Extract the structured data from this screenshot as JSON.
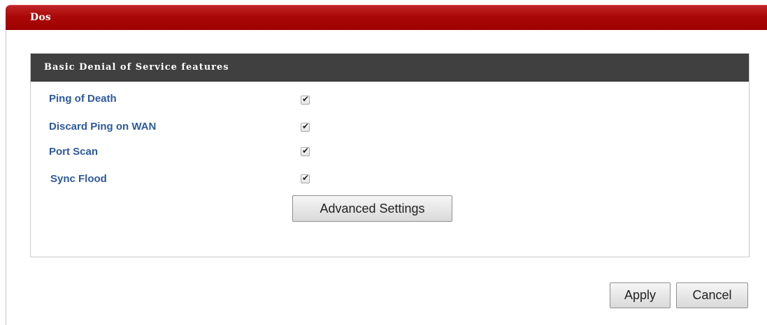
{
  "header": {
    "title": "Dos"
  },
  "panel": {
    "title": "Basic Denial of Service features",
    "rows": [
      {
        "label": "Ping of Death",
        "checked": true
      },
      {
        "label": "Discard Ping on WAN",
        "checked": true
      },
      {
        "label": "Port Scan",
        "checked": true
      },
      {
        "label": "Sync Flood",
        "checked": true
      }
    ],
    "check_glyph": "✔",
    "advanced_button": "Advanced Settings"
  },
  "actions": {
    "apply": "Apply",
    "cancel": "Cancel"
  },
  "colors": {
    "title_bar": "#a30000",
    "panel_header": "#404040",
    "label_text": "#2d5a9c"
  }
}
